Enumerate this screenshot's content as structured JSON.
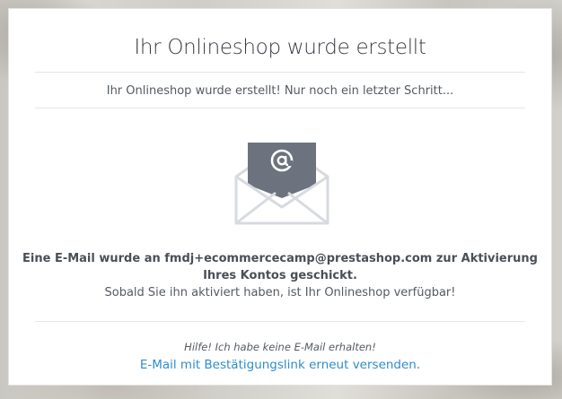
{
  "dialog": {
    "title": "Ihr Onlineshop wurde erstellt",
    "subtitle": "Ihr Onlineshop wurde erstellt! Nur noch ein letzter Schritt...",
    "icon": "email-envelope-icon",
    "message_line1": "Eine E-Mail wurde an fmdj+ecommercecamp@prestashop.com zur Aktivierung",
    "message_line2": "Ihres Kontos geschickt.",
    "message_line3": "Sobald Sie ihn aktiviert haben, ist Ihr Onlineshop verfügbar!",
    "help_text": "Hilfe! Ich habe keine E-Mail erhalten!",
    "resend_link": "E-Mail mit Bestätigungslink erneut versenden."
  },
  "colors": {
    "title": "#363a41",
    "text": "#555a62",
    "link": "#2f8dc9",
    "envelope_dark": "#6c737f",
    "envelope_light": "#d7dadf"
  }
}
